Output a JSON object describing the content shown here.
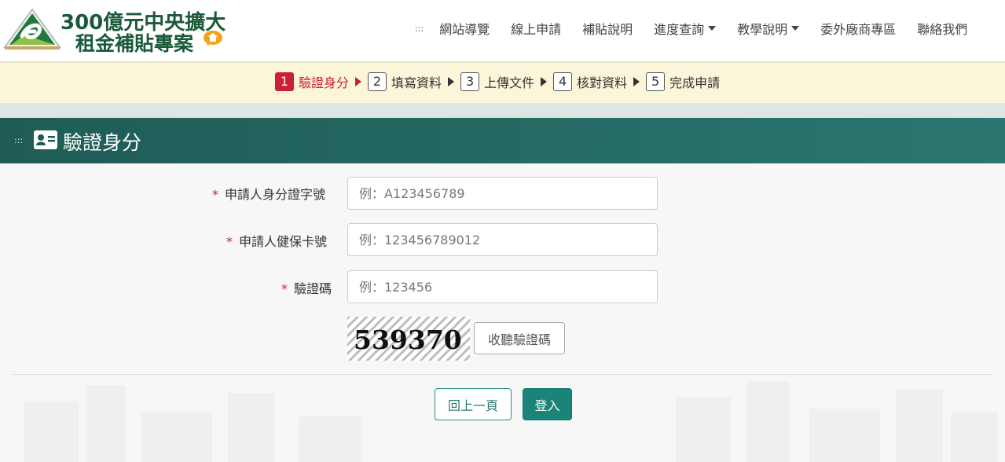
{
  "header": {
    "logo_line1": "300億元中央擴大",
    "logo_line2": "租金補貼專案",
    "nav_dots": ":::",
    "nav": [
      {
        "label": "網站導覽",
        "dropdown": false
      },
      {
        "label": "線上申請",
        "dropdown": false
      },
      {
        "label": "補貼說明",
        "dropdown": false
      },
      {
        "label": "進度查詢",
        "dropdown": true
      },
      {
        "label": "教學說明",
        "dropdown": true
      },
      {
        "label": "委外廠商專區",
        "dropdown": false
      },
      {
        "label": "聯絡我們",
        "dropdown": false
      }
    ]
  },
  "steps": [
    {
      "num": "1",
      "label": "驗證身分",
      "active": true
    },
    {
      "num": "2",
      "label": "填寫資料",
      "active": false
    },
    {
      "num": "3",
      "label": "上傳文件",
      "active": false
    },
    {
      "num": "4",
      "label": "核對資料",
      "active": false
    },
    {
      "num": "5",
      "label": "完成申請",
      "active": false
    }
  ],
  "section": {
    "dots": ":::",
    "title": "驗證身分"
  },
  "form": {
    "required_mark": "*",
    "id_label": "申請人身分證字號",
    "id_placeholder": "例：A123456789",
    "nhi_label": "申請人健保卡號",
    "nhi_placeholder": "例：123456789012",
    "captcha_label": "驗證碼",
    "captcha_placeholder": "例：123456",
    "captcha_code": "539370",
    "listen_label": "收聽驗證碼"
  },
  "buttons": {
    "back": "回上一頁",
    "login": "登入"
  },
  "colors": {
    "brand_green": "#1a5a38",
    "section_teal": "#1f5c56",
    "accent_red": "#cc1f3a",
    "steps_bg": "#fbf6d9",
    "button_teal": "#1a8478"
  }
}
